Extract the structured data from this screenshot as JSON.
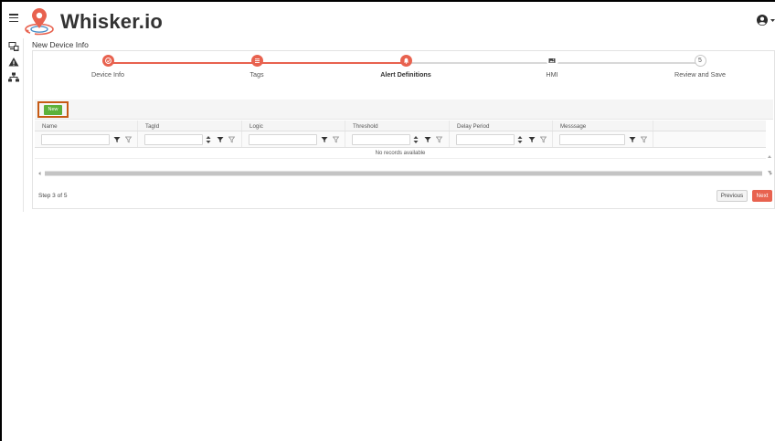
{
  "app": {
    "name": "Whisker.io",
    "brand_color": "#e8624f",
    "accent_color": "#5cb13a",
    "highlight_color": "#c65a14"
  },
  "header": {
    "menu_icon": "hamburger-icon",
    "logo_icon": "location-pin-icon",
    "user_icon": "user-circle-icon",
    "user_dropdown_icon": "caret-down-icon"
  },
  "sidebar": {
    "items": [
      {
        "icon": "devices-icon"
      },
      {
        "icon": "alert-triangle-icon"
      },
      {
        "icon": "sitemap-icon"
      }
    ]
  },
  "page": {
    "title": "New Device Info"
  },
  "stepper": {
    "current_step": 3,
    "steps": [
      {
        "label": "Device Info",
        "state": "done",
        "icon": "check-icon"
      },
      {
        "label": "Tags",
        "state": "done",
        "icon": "list-icon"
      },
      {
        "label": "Alert Definitions",
        "state": "active",
        "icon": "bell-icon"
      },
      {
        "label": "HMI",
        "state": "todo",
        "icon": "image-icon"
      },
      {
        "label": "Review and Save",
        "state": "todo",
        "number": "5"
      }
    ]
  },
  "grid": {
    "new_label": "New",
    "columns": [
      "Name",
      "TagId",
      "Logic",
      "Threshold",
      "Delay Period",
      "Messsage"
    ],
    "empty_message": "No records available",
    "filter_icon": "filter-icon",
    "clear_filter_icon": "filter-clear-icon"
  },
  "footer": {
    "step_text": "Step 3 of 5",
    "previous_label": "Previous",
    "next_label": "Next"
  }
}
